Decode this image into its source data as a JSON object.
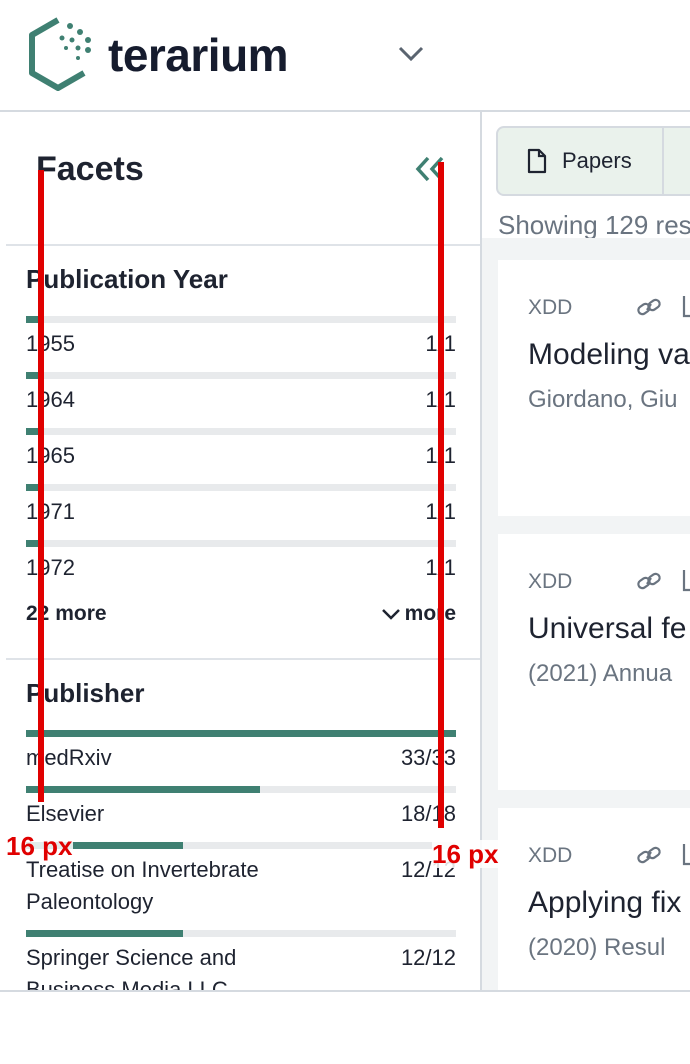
{
  "header": {
    "brand": "terarium",
    "logo_icon": "terarium-logo-icon",
    "menu_icon": "chevron-down-icon"
  },
  "facets": {
    "title": "Facets",
    "collapse_icon": "double-chevron-left-icon",
    "publication_year": {
      "title": "Publication Year",
      "items": [
        {
          "label": "1955",
          "count": "1/1",
          "fill": 0.03
        },
        {
          "label": "1964",
          "count": "1/1",
          "fill": 0.03
        },
        {
          "label": "1965",
          "count": "1/1",
          "fill": 0.03
        },
        {
          "label": "1971",
          "count": "1/1",
          "fill": 0.03
        },
        {
          "label": "1972",
          "count": "1/1",
          "fill": 0.03
        }
      ],
      "more_count": "22 more",
      "more_toggle": "more"
    },
    "publisher": {
      "title": "Publisher",
      "items": [
        {
          "label": "medRxiv",
          "count": "33/33",
          "fill": 1.0
        },
        {
          "label": "Elsevier",
          "count": "18/18",
          "fill": 0.545
        },
        {
          "label": "Treatise on Invertebrate Paleontology",
          "count": "12/12",
          "fill": 0.364
        },
        {
          "label": "Springer Science and Business Media LLC",
          "count": "12/12",
          "fill": 0.364
        }
      ]
    }
  },
  "tabs": {
    "papers": "Papers",
    "papers_icon": "document-icon"
  },
  "results": {
    "showing": "Showing 129 res",
    "cards": [
      {
        "source": "XDD",
        "title": "Modeling va",
        "subtitle": "Giordano, Giu"
      },
      {
        "source": "XDD",
        "title": "Universal fe",
        "subtitle": "(2021) Annua"
      },
      {
        "source": "XDD",
        "title": "Applying fix",
        "subtitle": "(2020) Resul"
      }
    ]
  },
  "annotations": {
    "left_measure": "16 px",
    "right_measure": "16 px",
    "color": "#e00000"
  },
  "colors": {
    "accent": "#3f8072",
    "track": "#e8eaec",
    "tab_bg": "#eaf2ec"
  }
}
